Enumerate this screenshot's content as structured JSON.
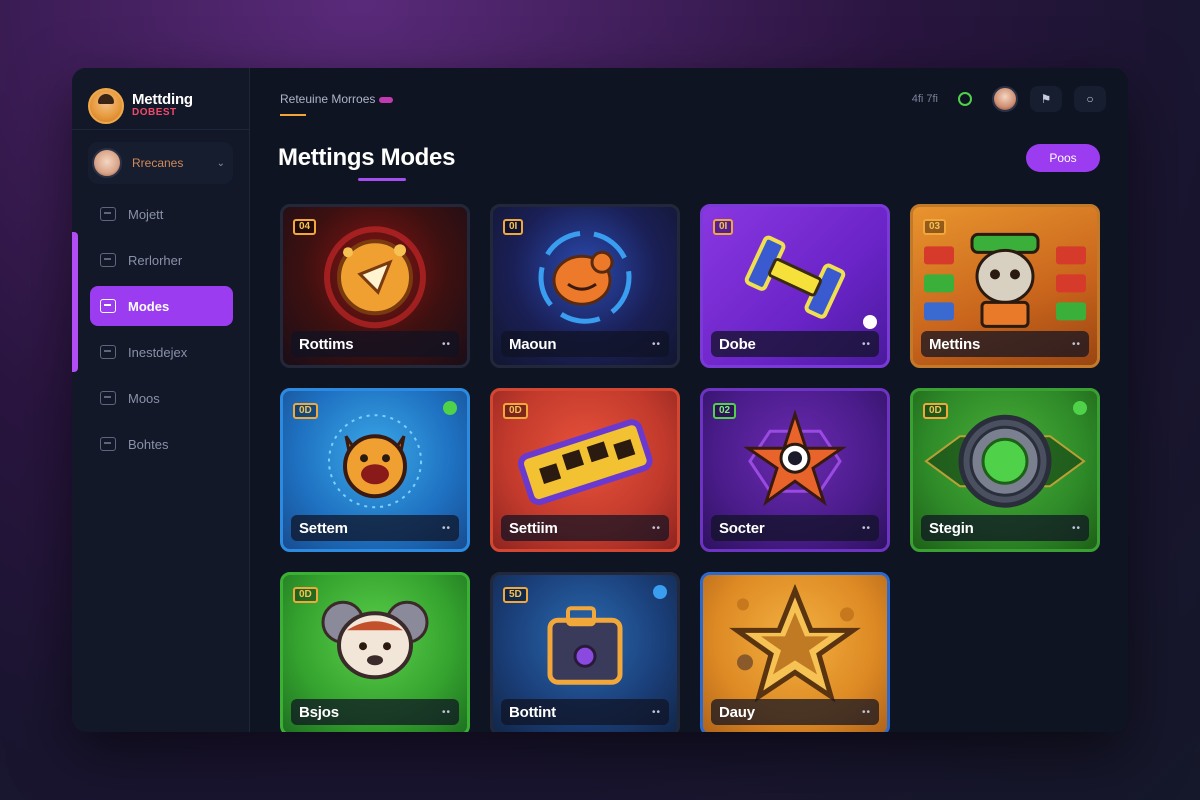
{
  "brand": {
    "title": "Mettding",
    "subtitle": "DOBEST"
  },
  "profile": {
    "name": "Rrecanes"
  },
  "nav": [
    {
      "label": "Mojett",
      "icon": "grid-icon"
    },
    {
      "label": "Rerlorher",
      "icon": "document-icon"
    },
    {
      "label": "Modes",
      "icon": "modes-icon",
      "active": true
    },
    {
      "label": "Inestdejex",
      "icon": "list-icon"
    },
    {
      "label": "Moos",
      "icon": "refresh-icon"
    },
    {
      "label": "Bohtes",
      "icon": "shield-icon"
    }
  ],
  "topbar": {
    "breadcrumb": "Reteuine Morroes",
    "status_text": "4fi 7fi"
  },
  "page": {
    "title": "Mettings Modes",
    "action_label": "Poos"
  },
  "cards": [
    {
      "label": "Rottims",
      "badge": "04",
      "theme": "red",
      "art": "shield-emblem"
    },
    {
      "label": "Maoun",
      "badge": "0I",
      "theme": "blue",
      "art": "orange-blob"
    },
    {
      "label": "Dobe",
      "badge": "0I",
      "theme": "purple",
      "art": "dumbbell"
    },
    {
      "label": "Mettins",
      "badge": "03",
      "theme": "orange",
      "art": "character-board"
    },
    {
      "label": "Settem",
      "badge": "0D",
      "theme": "sky-blue",
      "art": "creature-face"
    },
    {
      "label": "Settiim",
      "badge": "0D",
      "theme": "red-orange",
      "art": "gold-bar"
    },
    {
      "label": "Socter",
      "badge": "02",
      "theme": "violet",
      "art": "star-eye"
    },
    {
      "label": "Stegin",
      "badge": "0D",
      "theme": "green",
      "art": "vault-gear"
    },
    {
      "label": "Bsjos",
      "badge": "0D",
      "theme": "lime",
      "art": "koala-creature"
    },
    {
      "label": "Bottint",
      "badge": "5D",
      "theme": "navy",
      "art": "briefcase"
    },
    {
      "label": "Dauy",
      "badge": "",
      "theme": "gold",
      "art": "big-star"
    }
  ],
  "colors": {
    "accent": "#9b3cf0",
    "badge_border": "#f2a73a",
    "brand_sub": "#f04a6a",
    "status_green": "#4fd14a"
  }
}
